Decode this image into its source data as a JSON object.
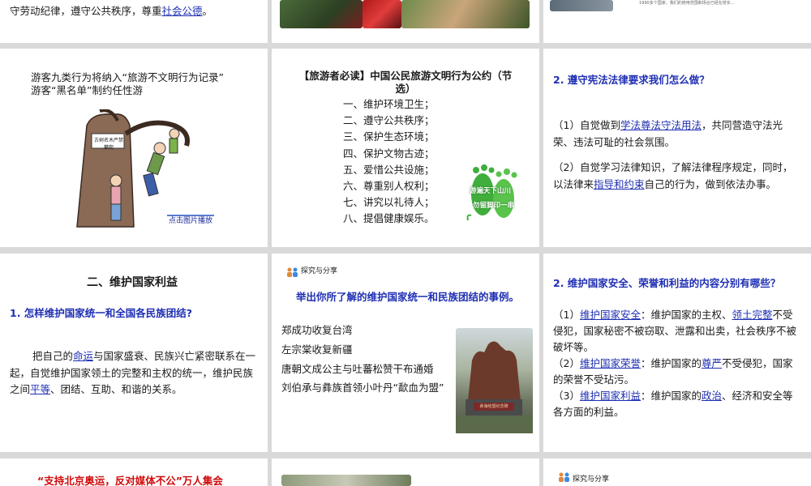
{
  "row1": {
    "left_text_prefix": "守劳动纪律，遵守公共秩序，尊重",
    "left_link": "社会公德",
    "left_text_suffix": "。",
    "right_caption_1": "1990多个国家，我们的使用范围和场合已经在增长..."
  },
  "slide_tourists": {
    "title": "游客九类行为将纳入“旅游不文明行为记录”  游客“黑名单”制约任性游",
    "sign_text": "古树名木严禁攀爬",
    "play_button": "点击图片播放"
  },
  "slide_convention": {
    "title_bracket": "【旅游者必读】",
    "title_main": "中国公民旅游文明行为公约（节选）",
    "items": [
      "一、维护环境卫生；",
      "二、遵守公共秩序；",
      "三、保护生态环境；",
      "四、保护文物古迹；",
      "五、爱惜公共设施；",
      "六、尊重别人权利；",
      "七、讲究以礼待人；",
      "八、提倡健康娱乐。"
    ],
    "footprint_text_1": "游遍天下山川",
    "footprint_text_2": "勿留脚印一串"
  },
  "slide_law": {
    "heading": "2. 遵守宪法法律要求我们怎么做？",
    "p1_a": "（1）自觉做到",
    "p1_link": "学法尊法守法用法",
    "p1_b": "，共同营造守法光荣、违法可耻的社会氛围。",
    "p2_a": "（2）自觉学习法律知识，了解法律程序规定，同时，以法律来",
    "p2_link": "指导和约束",
    "p2_b": "自己的行为，做到依法办事。"
  },
  "slide_nation": {
    "section_title": "二、维护国家利益",
    "question": "1. 怎样维护国家统一和全国各民族团结?",
    "p_a": "把自己的",
    "p_link1": "命运",
    "p_b": "与国家盛衰、民族兴亡紧密联系在一起，自觉维护国家领土的完整和主权的统一，维护民族之间",
    "p_link2": "平等",
    "p_c": "、团结、互助、和谐的关系。"
  },
  "slide_explore": {
    "badge": "探究与分享",
    "heading": "举出你所了解的维护国家统一和民族团结的事例。",
    "examples": [
      "郑成功收复台湾",
      "左宗棠收复新疆",
      "唐朝文成公主与吐蕃松赞干布通婚",
      "刘伯承与彝族首领小叶丹“歃血为盟”"
    ],
    "statue_plaque": "彝海结盟纪念碑"
  },
  "slide_security": {
    "heading": "2. 维护国家安全、荣誉和利益的内容分别有哪些？",
    "l1_a": "（1）",
    "l1_link1": "维护国家安全",
    "l1_b": "：维护国家的主权、",
    "l1_link2": "领土完整",
    "l1_c": "不受侵犯，国家秘密不被窃取、泄露和出卖，社会秩序不被破坏等。",
    "l2_a": "（2）",
    "l2_link1": "维护国家荣誉",
    "l2_b": "：维护国家的",
    "l2_link2": "尊严",
    "l2_c": "不受侵犯，国家的荣誉不受玷污。",
    "l3_a": "（3）",
    "l3_link1": "维护国家利益",
    "l3_b": "：维护国家的",
    "l3_link2": "政治",
    "l3_c": "、经济和安全等各方面的利益。"
  },
  "row4": {
    "left_title": "“支持北京奥运，反对媒体不公”万人集会",
    "right_badge": "探究与分享"
  }
}
